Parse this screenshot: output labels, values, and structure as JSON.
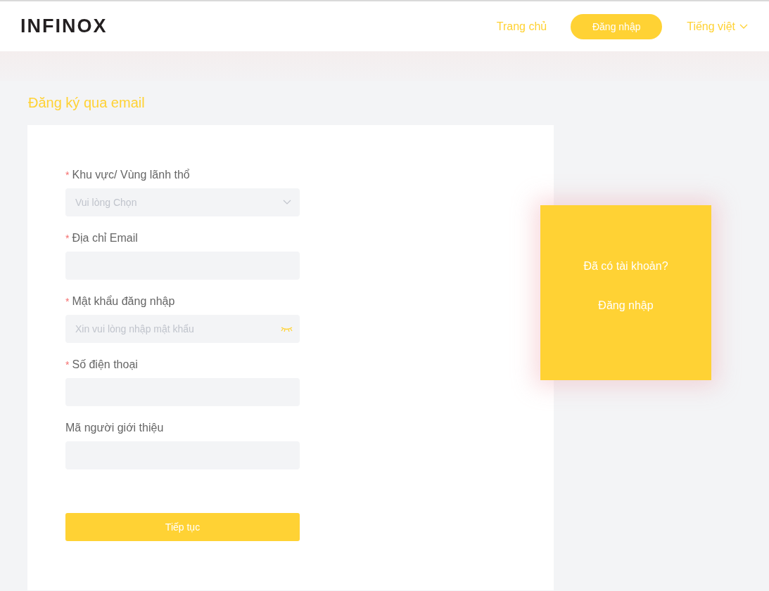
{
  "header": {
    "logo": "INFINOX",
    "nav": [
      {
        "kind": "link",
        "label": "Trang chủ"
      },
      {
        "kind": "button",
        "label": "Đăng nhập"
      },
      {
        "kind": "dropdown",
        "label": "Tiếng việt"
      }
    ]
  },
  "page": {
    "title": "Đăng ký qua email"
  },
  "form": {
    "fields": [
      {
        "kind": "select",
        "required_mark": "*",
        "label": "Khu vực/ Vùng lãnh thổ",
        "placeholder": "Vui lòng Chọn"
      },
      {
        "kind": "text",
        "required_mark": "*",
        "label": "Địa chỉ Email"
      },
      {
        "kind": "password",
        "required_mark": "*",
        "label": "Mật khẩu đăng nhập",
        "placeholder": "Xin vui lòng nhập mật khẩu"
      },
      {
        "kind": "text",
        "required_mark": "*",
        "label": "Số điện thoại"
      },
      {
        "kind": "text",
        "label": "Mã người giới thiệu"
      }
    ],
    "submit": "Tiếp tục"
  },
  "login_panel": {
    "question": "Đã có tài khoản?",
    "link": "Đăng nhập"
  }
}
